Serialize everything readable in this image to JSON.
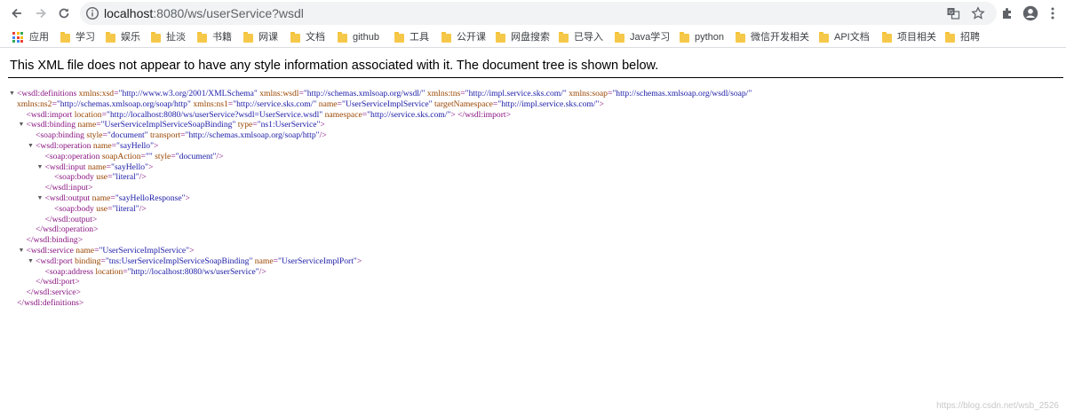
{
  "browser": {
    "url_host": "localhost",
    "url_rest": ":8080/ws/userService?wsdl",
    "icons": {
      "back": "back-arrow-icon",
      "forward": "forward-arrow-icon",
      "reload": "reload-icon",
      "site_info": "info-icon",
      "translate": "translate-icon",
      "bookmark": "star-icon",
      "extensions": "puzzle-icon",
      "profile": "account-icon",
      "menu": "kebab-menu-icon"
    }
  },
  "bookmarks": [
    {
      "label": "应用",
      "type": "apps"
    },
    {
      "label": "学习",
      "type": "folder"
    },
    {
      "label": "娱乐",
      "type": "folder"
    },
    {
      "label": "扯淡",
      "type": "folder"
    },
    {
      "label": "书籍",
      "type": "folder"
    },
    {
      "label": "网课",
      "type": "folder"
    },
    {
      "label": "文档",
      "type": "folder"
    },
    {
      "label": "github",
      "type": "folder"
    },
    {
      "label": "工具",
      "type": "folder"
    },
    {
      "label": "公开课",
      "type": "folder"
    },
    {
      "label": "网盘搜索",
      "type": "folder"
    },
    {
      "label": "已导入",
      "type": "folder"
    },
    {
      "label": "Java学习",
      "type": "folder"
    },
    {
      "label": "python",
      "type": "folder"
    },
    {
      "label": "微信开发相关",
      "type": "folder"
    },
    {
      "label": "API文档",
      "type": "folder"
    },
    {
      "label": "项目相关",
      "type": "folder"
    },
    {
      "label": "招聘",
      "type": "folder"
    }
  ],
  "viewer": {
    "notice": "This XML file does not appear to have any style information associated with it. The document tree is shown below.",
    "collapse_glyph": "▼"
  },
  "xml_lines": [
    {
      "indent": 0,
      "arrow": true,
      "text": "<wsdl:definitions xmlns:xsd=\"http://www.w3.org/2001/XMLSchema\" xmlns:wsdl=\"http://schemas.xmlsoap.org/wsdl/\" xmlns:tns=\"http://impl.service.sks.com/\" xmlns:soap=\"http://schemas.xmlsoap.org/wsdl/soap/\""
    },
    {
      "indent": 0,
      "arrow": false,
      "text": "xmlns:ns2=\"http://schemas.xmlsoap.org/soap/http\" xmlns:ns1=\"http://service.sks.com/\" name=\"UserServiceImplService\" targetNamespace=\"http://impl.service.sks.com/\">"
    },
    {
      "indent": 1,
      "arrow": false,
      "text": "<wsdl:import location=\"http://localhost:8080/ws/userService?wsdl=UserService.wsdl\" namespace=\"http://service.sks.com/\"> </wsdl:import>"
    },
    {
      "indent": 1,
      "arrow": true,
      "text": "<wsdl:binding name=\"UserServiceImplServiceSoapBinding\" type=\"ns1:UserService\">"
    },
    {
      "indent": 2,
      "arrow": false,
      "text": "<soap:binding style=\"document\" transport=\"http://schemas.xmlsoap.org/soap/http\"/>"
    },
    {
      "indent": 2,
      "arrow": true,
      "text": "<wsdl:operation name=\"sayHello\">"
    },
    {
      "indent": 3,
      "arrow": false,
      "text": "<soap:operation soapAction=\"\" style=\"document\"/>"
    },
    {
      "indent": 3,
      "arrow": true,
      "text": "<wsdl:input name=\"sayHello\">"
    },
    {
      "indent": 4,
      "arrow": false,
      "text": "<soap:body use=\"literal\"/>"
    },
    {
      "indent": 3,
      "arrow": false,
      "text": "</wsdl:input>"
    },
    {
      "indent": 3,
      "arrow": true,
      "text": "<wsdl:output name=\"sayHelloResponse\">"
    },
    {
      "indent": 4,
      "arrow": false,
      "text": "<soap:body use=\"literal\"/>"
    },
    {
      "indent": 3,
      "arrow": false,
      "text": "</wsdl:output>"
    },
    {
      "indent": 2,
      "arrow": false,
      "text": "</wsdl:operation>"
    },
    {
      "indent": 1,
      "arrow": false,
      "text": "</wsdl:binding>"
    },
    {
      "indent": 1,
      "arrow": true,
      "text": "<wsdl:service name=\"UserServiceImplService\">"
    },
    {
      "indent": 2,
      "arrow": true,
      "text": "<wsdl:port binding=\"tns:UserServiceImplServiceSoapBinding\" name=\"UserServiceImplPort\">"
    },
    {
      "indent": 3,
      "arrow": false,
      "text": "<soap:address location=\"http://localhost:8080/ws/userService\"/>"
    },
    {
      "indent": 2,
      "arrow": false,
      "text": "</wsdl:port>"
    },
    {
      "indent": 1,
      "arrow": false,
      "text": "</wsdl:service>"
    },
    {
      "indent": 0,
      "arrow": false,
      "text": "</wsdl:definitions>"
    }
  ],
  "watermark": "https://blog.csdn.net/wsb_2526",
  "colors": {
    "tag": "#881280",
    "attr_name": "#994500",
    "attr_value": "#1a1aa6",
    "folder": "#f6c84a",
    "omnibox_bg": "#f1f3f4"
  }
}
